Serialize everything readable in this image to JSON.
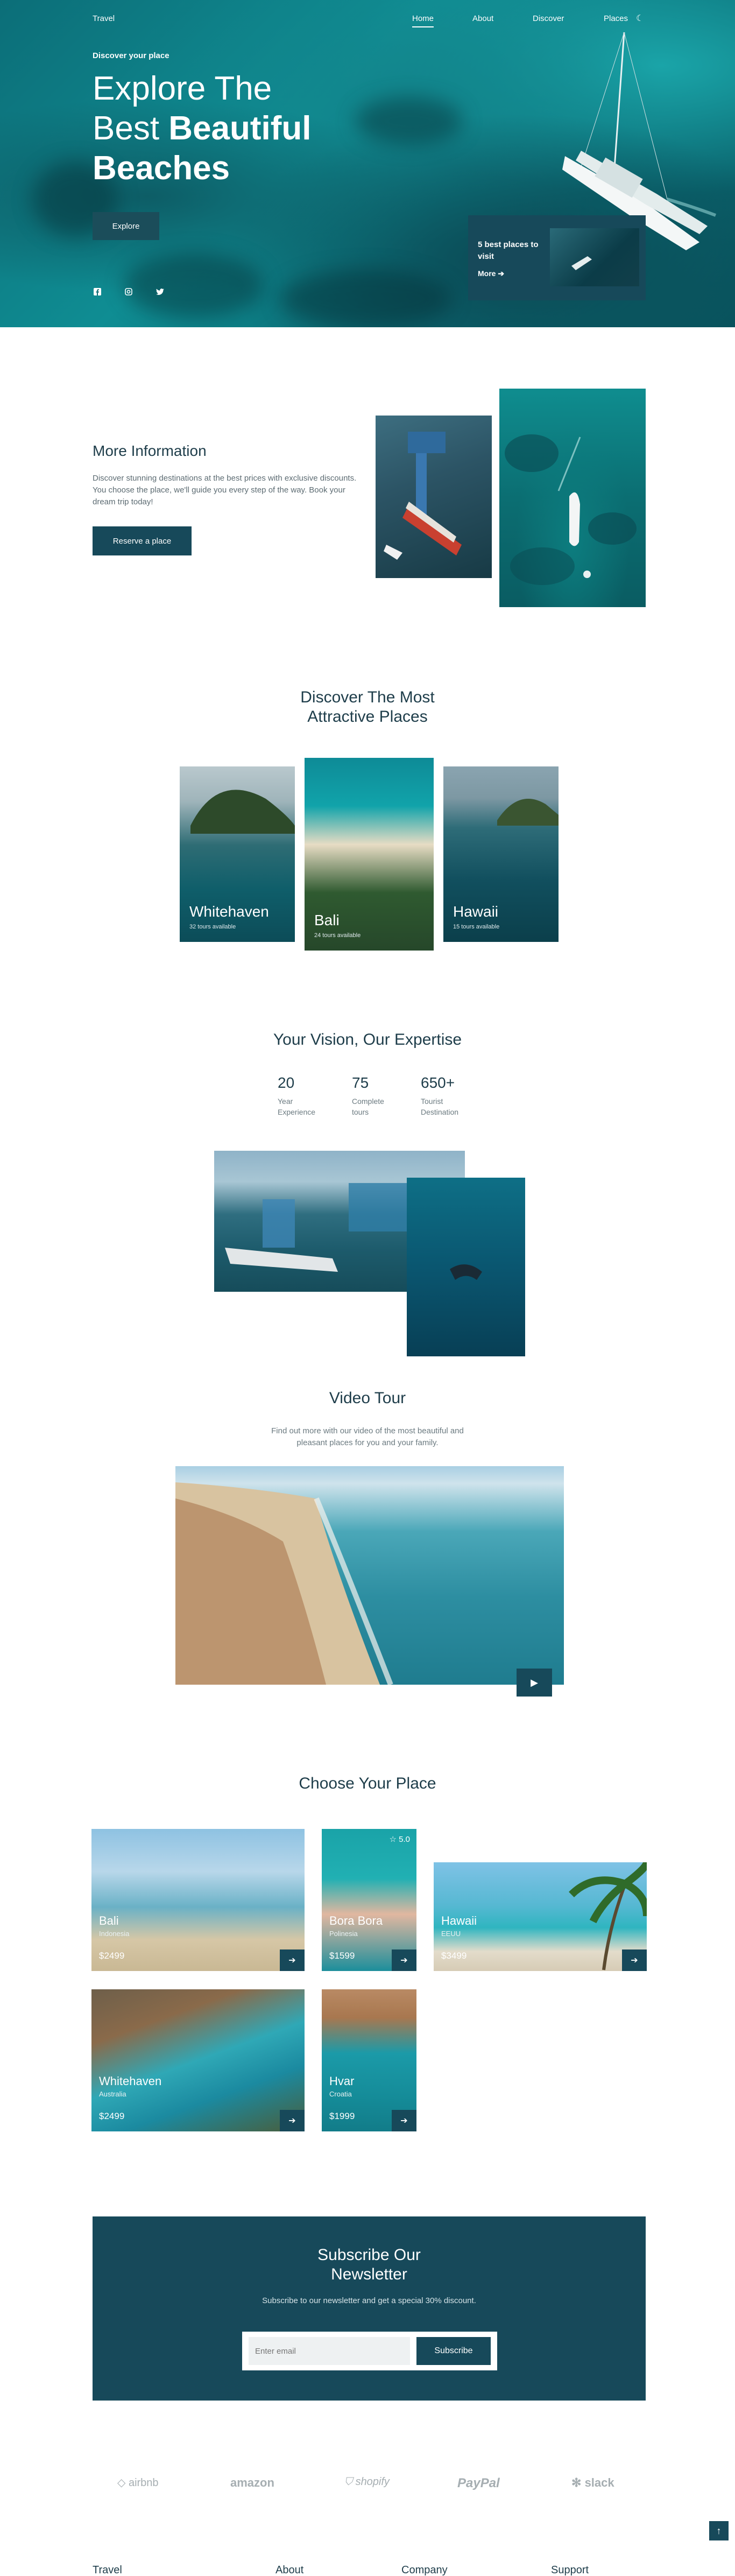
{
  "nav": {
    "logo": "Travel",
    "items": [
      "Home",
      "About",
      "Discover",
      "Places"
    ]
  },
  "hero": {
    "kicker": "Discover your place",
    "title_line1": "Explore The",
    "title_line2_plain": "Best ",
    "title_line2_bold": "Beautiful",
    "title_line3": "Beaches",
    "button": "Explore",
    "card_title": "5 best places to visit",
    "card_more": "More"
  },
  "info": {
    "title": "More Information",
    "text": "Discover stunning destinations at the best prices with exclusive discounts. You choose the place, we'll guide you every step of the way. Book your dream trip today!",
    "button": "Reserve a place"
  },
  "discover": {
    "title_line1": "Discover The Most",
    "title_line2": "Attractive Places",
    "places": [
      {
        "name": "Whitehaven",
        "sub": "32 tours available"
      },
      {
        "name": "Bali",
        "sub": "24 tours available"
      },
      {
        "name": "Hawaii",
        "sub": "15 tours available"
      }
    ]
  },
  "expertise": {
    "title": "Your Vision, Our Expertise",
    "stats": [
      {
        "num": "20",
        "l1": "Year",
        "l2": "Experience"
      },
      {
        "num": "75",
        "l1": "Complete",
        "l2": "tours"
      },
      {
        "num": "650+",
        "l1": "Tourist",
        "l2": "Destination"
      }
    ]
  },
  "video": {
    "title": "Video Tour",
    "text_line1": "Find out more with our video of the most beautiful and",
    "text_line2": "pleasant places for you and your family."
  },
  "choose": {
    "title": "Choose Your Place",
    "cards": [
      {
        "name": "Bali",
        "country": "Indonesia",
        "price": "$2499"
      },
      {
        "name": "Bora Bora",
        "country": "Polinesia",
        "price": "$1599",
        "rating": "5.0"
      },
      {
        "name": "Hawaii",
        "country": "EEUU",
        "price": "$3499"
      },
      {
        "name": "Whitehaven",
        "country": "Australia",
        "price": "$2499"
      },
      {
        "name": "Hvar",
        "country": "Croatia",
        "price": "$1999"
      }
    ]
  },
  "newsletter": {
    "title_line1": "Subscribe Our",
    "title_line2": "Newsletter",
    "text": "Subscribe to our newsletter and get a special 30% discount.",
    "placeholder": "Enter email",
    "button": "Subscribe"
  },
  "brands": [
    "airbnb",
    "amazon",
    "shopify",
    "PayPal",
    "slack"
  ],
  "footer": {
    "cols": [
      "Travel",
      "About",
      "Company",
      "Support"
    ]
  },
  "colors": {
    "primary": "#17495a",
    "text": "#1e3d4a"
  }
}
